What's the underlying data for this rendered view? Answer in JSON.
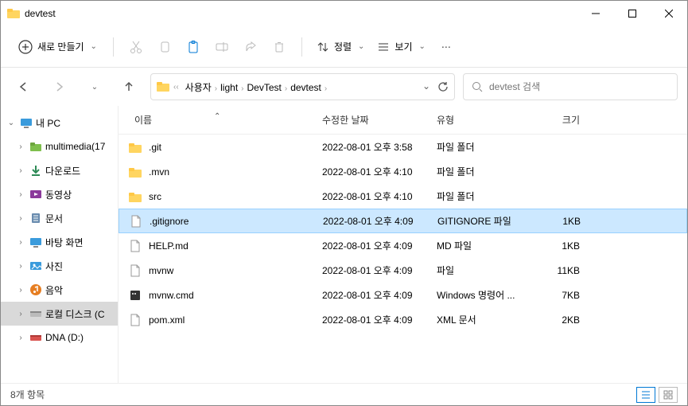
{
  "window": {
    "title": "devtest"
  },
  "toolbar": {
    "new_label": "새로 만들기",
    "sort_label": "정렬",
    "view_label": "보기"
  },
  "breadcrumb": {
    "items": [
      "사용자",
      "light",
      "DevTest",
      "devtest"
    ]
  },
  "search": {
    "placeholder": "devtest 검색"
  },
  "sidebar": [
    {
      "label": "내 PC",
      "icon": "pc",
      "depth": 0,
      "expanded": true,
      "hasChildren": true
    },
    {
      "label": "multimedia(17",
      "icon": "folder-green",
      "depth": 1,
      "hasChildren": true
    },
    {
      "label": "다운로드",
      "icon": "download",
      "depth": 1,
      "hasChildren": true
    },
    {
      "label": "동영상",
      "icon": "video",
      "depth": 1,
      "hasChildren": true
    },
    {
      "label": "문서",
      "icon": "document",
      "depth": 1,
      "hasChildren": true
    },
    {
      "label": "바탕 화면",
      "icon": "desktop",
      "depth": 1,
      "hasChildren": true
    },
    {
      "label": "사진",
      "icon": "pictures",
      "depth": 1,
      "hasChildren": true
    },
    {
      "label": "음악",
      "icon": "music",
      "depth": 1,
      "hasChildren": true
    },
    {
      "label": "로컬 디스크 (C",
      "icon": "disk",
      "depth": 1,
      "hasChildren": true,
      "selected": true
    },
    {
      "label": "DNA (D:)",
      "icon": "disk-red",
      "depth": 1,
      "hasChildren": true
    }
  ],
  "columns": {
    "name": "이름",
    "date": "수정한 날짜",
    "type": "유형",
    "size": "크기"
  },
  "files": [
    {
      "name": ".git",
      "date": "2022-08-01 오후 3:58",
      "type": "파일 폴더",
      "size": "",
      "icon": "folder"
    },
    {
      "name": ".mvn",
      "date": "2022-08-01 오후 4:10",
      "type": "파일 폴더",
      "size": "",
      "icon": "folder"
    },
    {
      "name": "src",
      "date": "2022-08-01 오후 4:10",
      "type": "파일 폴더",
      "size": "",
      "icon": "folder"
    },
    {
      "name": ".gitignore",
      "date": "2022-08-01 오후 4:09",
      "type": "GITIGNORE 파일",
      "size": "1KB",
      "icon": "file",
      "selected": true
    },
    {
      "name": "HELP.md",
      "date": "2022-08-01 오후 4:09",
      "type": "MD 파일",
      "size": "1KB",
      "icon": "file"
    },
    {
      "name": "mvnw",
      "date": "2022-08-01 오후 4:09",
      "type": "파일",
      "size": "11KB",
      "icon": "file"
    },
    {
      "name": "mvnw.cmd",
      "date": "2022-08-01 오후 4:09",
      "type": "Windows 명령어 ...",
      "size": "7KB",
      "icon": "cmd"
    },
    {
      "name": "pom.xml",
      "date": "2022-08-01 오후 4:09",
      "type": "XML 문서",
      "size": "2KB",
      "icon": "file"
    }
  ],
  "status": {
    "count_label": "8개 항목"
  }
}
